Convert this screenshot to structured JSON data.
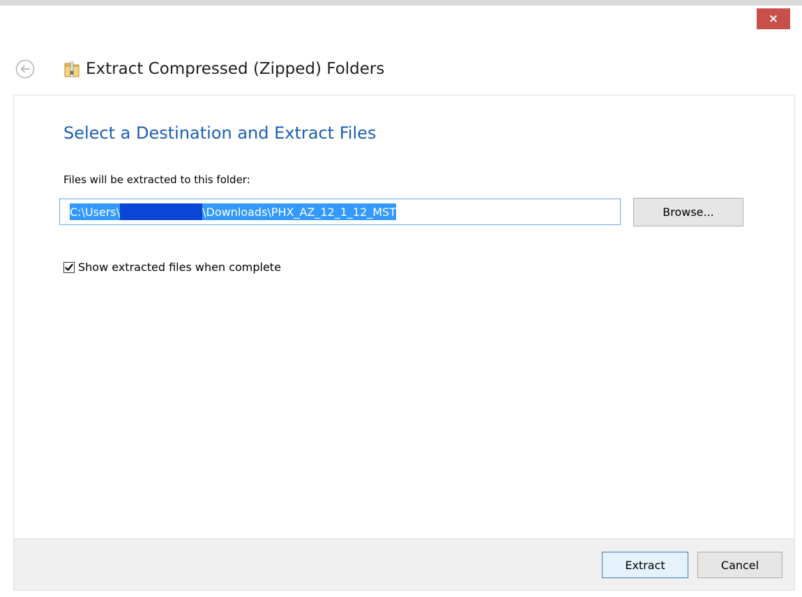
{
  "window": {
    "title": "Extract Compressed (Zipped) Folders",
    "close_label": "×"
  },
  "content": {
    "heading": "Select a Destination and Extract Files",
    "destination_label": "Files will be extracted to this folder:",
    "path_prefix": "C:\\Users\\",
    "path_suffix": "\\Downloads\\PHX_AZ_12_1_12_MST",
    "browse_label": "Browse...",
    "show_files_label": "Show extracted files when complete",
    "show_files_checked": true
  },
  "footer": {
    "extract_label": "Extract",
    "cancel_label": "Cancel"
  },
  "icons": {
    "back": "back-arrow-icon",
    "zip": "zip-folder-icon",
    "close": "close-icon",
    "check": "checkmark-icon"
  },
  "colors": {
    "heading": "#1a5fb4",
    "close_button": "#c7504b",
    "selection": "#3399ff",
    "redaction": "#0a46d6",
    "footer_bg": "#f0f0f0"
  }
}
